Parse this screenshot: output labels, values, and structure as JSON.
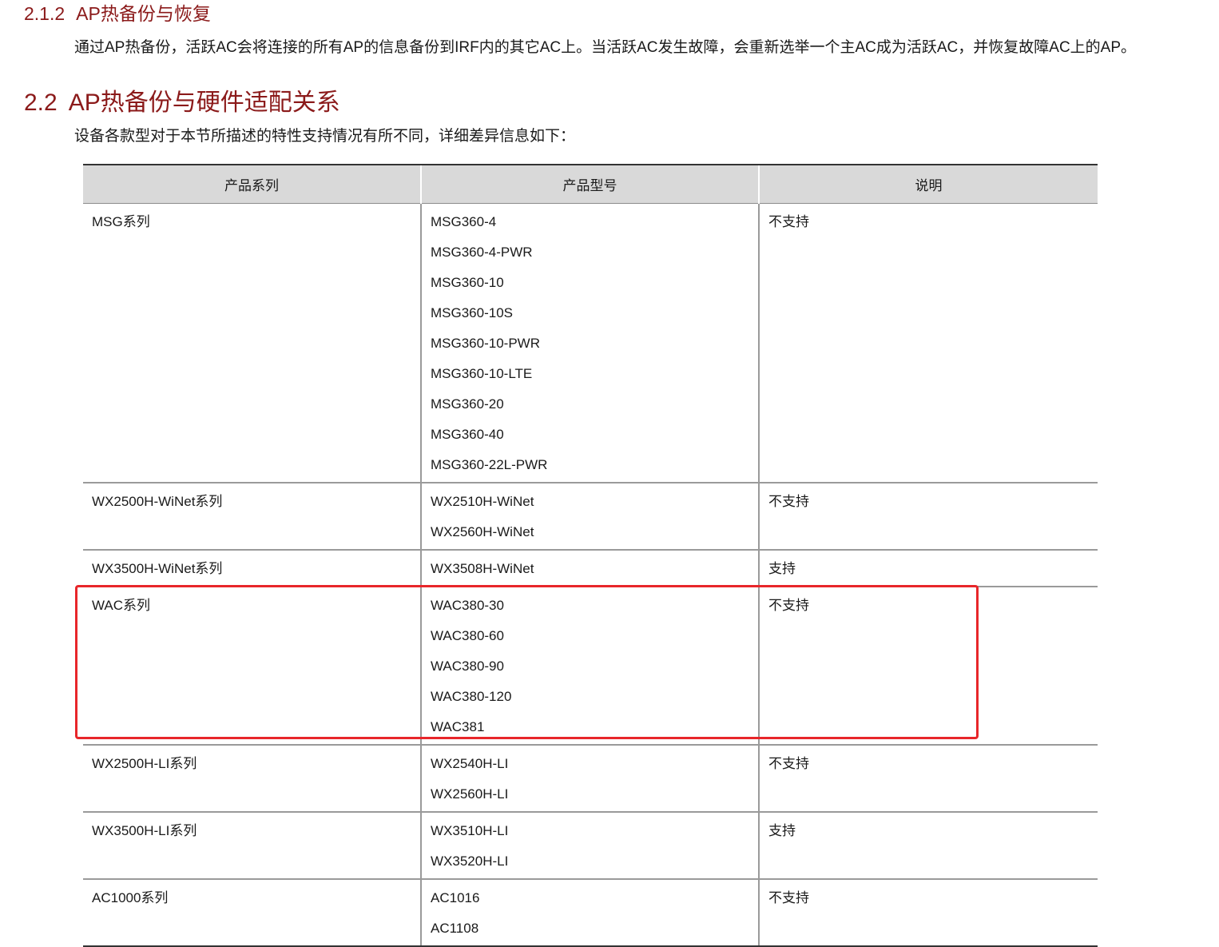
{
  "section_212": {
    "number": "2.1.2",
    "title": "AP热备份与恢复",
    "paragraph": "通过AP热备份，活跃AC会将连接的所有AP的信息备份到IRF内的其它AC上。当活跃AC发生故障，会重新选举一个主AC成为活跃AC，并恢复故障AC上的AP。"
  },
  "section_22": {
    "number": "2.2",
    "title": "AP热备份与硬件适配关系",
    "intro": "设备各款型对于本节所描述的特性支持情况有所不同，详细差异信息如下："
  },
  "table": {
    "headers": [
      "产品系列",
      "产品型号",
      "说明"
    ],
    "rows": [
      {
        "series": "MSG系列",
        "models": [
          "MSG360-4",
          "MSG360-4-PWR",
          "MSG360-10",
          "MSG360-10S",
          "MSG360-10-PWR",
          "MSG360-10-LTE",
          "MSG360-20",
          "MSG360-40",
          "MSG360-22L-PWR"
        ],
        "note": "不支持"
      },
      {
        "series": "WX2500H-WiNet系列",
        "models": [
          "WX2510H-WiNet",
          "WX2560H-WiNet"
        ],
        "note": "不支持"
      },
      {
        "series": "WX3500H-WiNet系列",
        "models": [
          "WX3508H-WiNet"
        ],
        "note": "支持"
      },
      {
        "series": "WAC系列",
        "models": [
          "WAC380-30",
          "WAC380-60",
          "WAC380-90",
          "WAC380-120",
          "WAC381"
        ],
        "note": "不支持"
      },
      {
        "series": "WX2500H-LI系列",
        "models": [
          "WX2540H-LI",
          "WX2560H-LI"
        ],
        "note": "不支持"
      },
      {
        "series": "WX3500H-LI系列",
        "models": [
          "WX3510H-LI",
          "WX3520H-LI"
        ],
        "note": "支持"
      },
      {
        "series": "AC1000系列",
        "models": [
          "AC1016",
          "AC1108"
        ],
        "note": "不支持"
      }
    ]
  },
  "colors": {
    "heading": "#8b1a1a",
    "header_bg": "#d9d9d9",
    "highlight": "#e8262a"
  }
}
